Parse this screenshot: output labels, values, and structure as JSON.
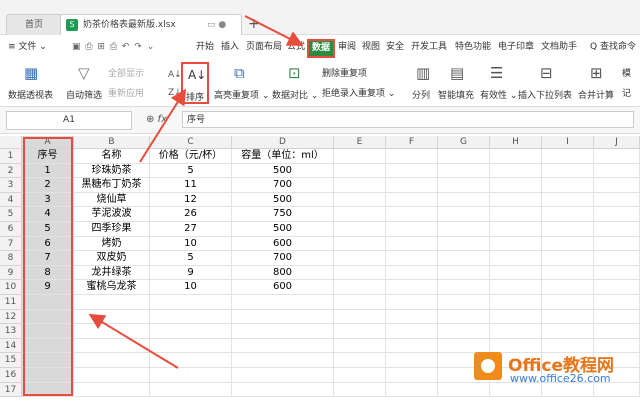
{
  "tabs": {
    "home": "首页",
    "file": "奶茶价格表最新版.xlsx",
    "file_icon": "S",
    "tab_controls": "▭ ●",
    "new_tab": "+"
  },
  "menu": {
    "items": [
      "≡ 文件 ⌄",
      "开始",
      "插入",
      "页面布局",
      "公式",
      "数据",
      "审阅",
      "视图",
      "安全",
      "开发工具",
      "特色功能",
      "电子印章",
      "文档助手"
    ],
    "search": "Q 查找命令",
    "quick_icons": "▣ ⎙ ⊞ ⎙ ↶ ↷ ⌄"
  },
  "ribbon": {
    "pivot": "数据透视表",
    "autofilter": "自动筛选",
    "show_all": "全部显示",
    "reapply": "重新应用",
    "sort": "排序",
    "highlight_dup": "高亮重复项 ⌄",
    "compare": "数据对比 ⌄",
    "remove_dup": "删除重复项",
    "reject_dup": "拒绝录入重复项 ⌄",
    "split": "分列",
    "smart_fill": "智能填充",
    "validity": "有效性 ⌄",
    "dropdown_list": "插入下拉列表",
    "consolidate": "合并计算",
    "more_1": "模",
    "more_2": "记"
  },
  "formula_bar": {
    "name_box": "A1",
    "fx": "⊕ fx",
    "content": "序号"
  },
  "columns": [
    "A",
    "B",
    "C",
    "D",
    "E",
    "F",
    "G",
    "H",
    "I",
    "J"
  ],
  "rows": [
    "1",
    "2",
    "3",
    "4",
    "5",
    "6",
    "7",
    "8",
    "9",
    "10",
    "11",
    "12",
    "13",
    "14",
    "15",
    "16",
    "17"
  ],
  "table": {
    "headers": [
      "序号",
      "名称",
      "价格（元/杯）",
      "容量（单位：ml）"
    ],
    "data": [
      [
        "1",
        "珍珠奶茶",
        "5",
        "500"
      ],
      [
        "2",
        "黑糖布丁奶茶",
        "11",
        "700"
      ],
      [
        "3",
        "烧仙草",
        "12",
        "500"
      ],
      [
        "4",
        "芋泥波波",
        "26",
        "750"
      ],
      [
        "5",
        "四季珍果",
        "27",
        "500"
      ],
      [
        "6",
        "烤奶",
        "10",
        "600"
      ],
      [
        "7",
        "双皮奶",
        "5",
        "700"
      ],
      [
        "8",
        "龙井绿茶",
        "9",
        "800"
      ],
      [
        "9",
        "蜜桃乌龙茶",
        "10",
        "600"
      ]
    ]
  },
  "watermark": {
    "title": "Office教程网",
    "url": "www.office26.com"
  },
  "colors": {
    "accent_green": "#2e8b3e",
    "highlight_red": "#e84c3d",
    "logo_orange": "#f08c1e"
  }
}
